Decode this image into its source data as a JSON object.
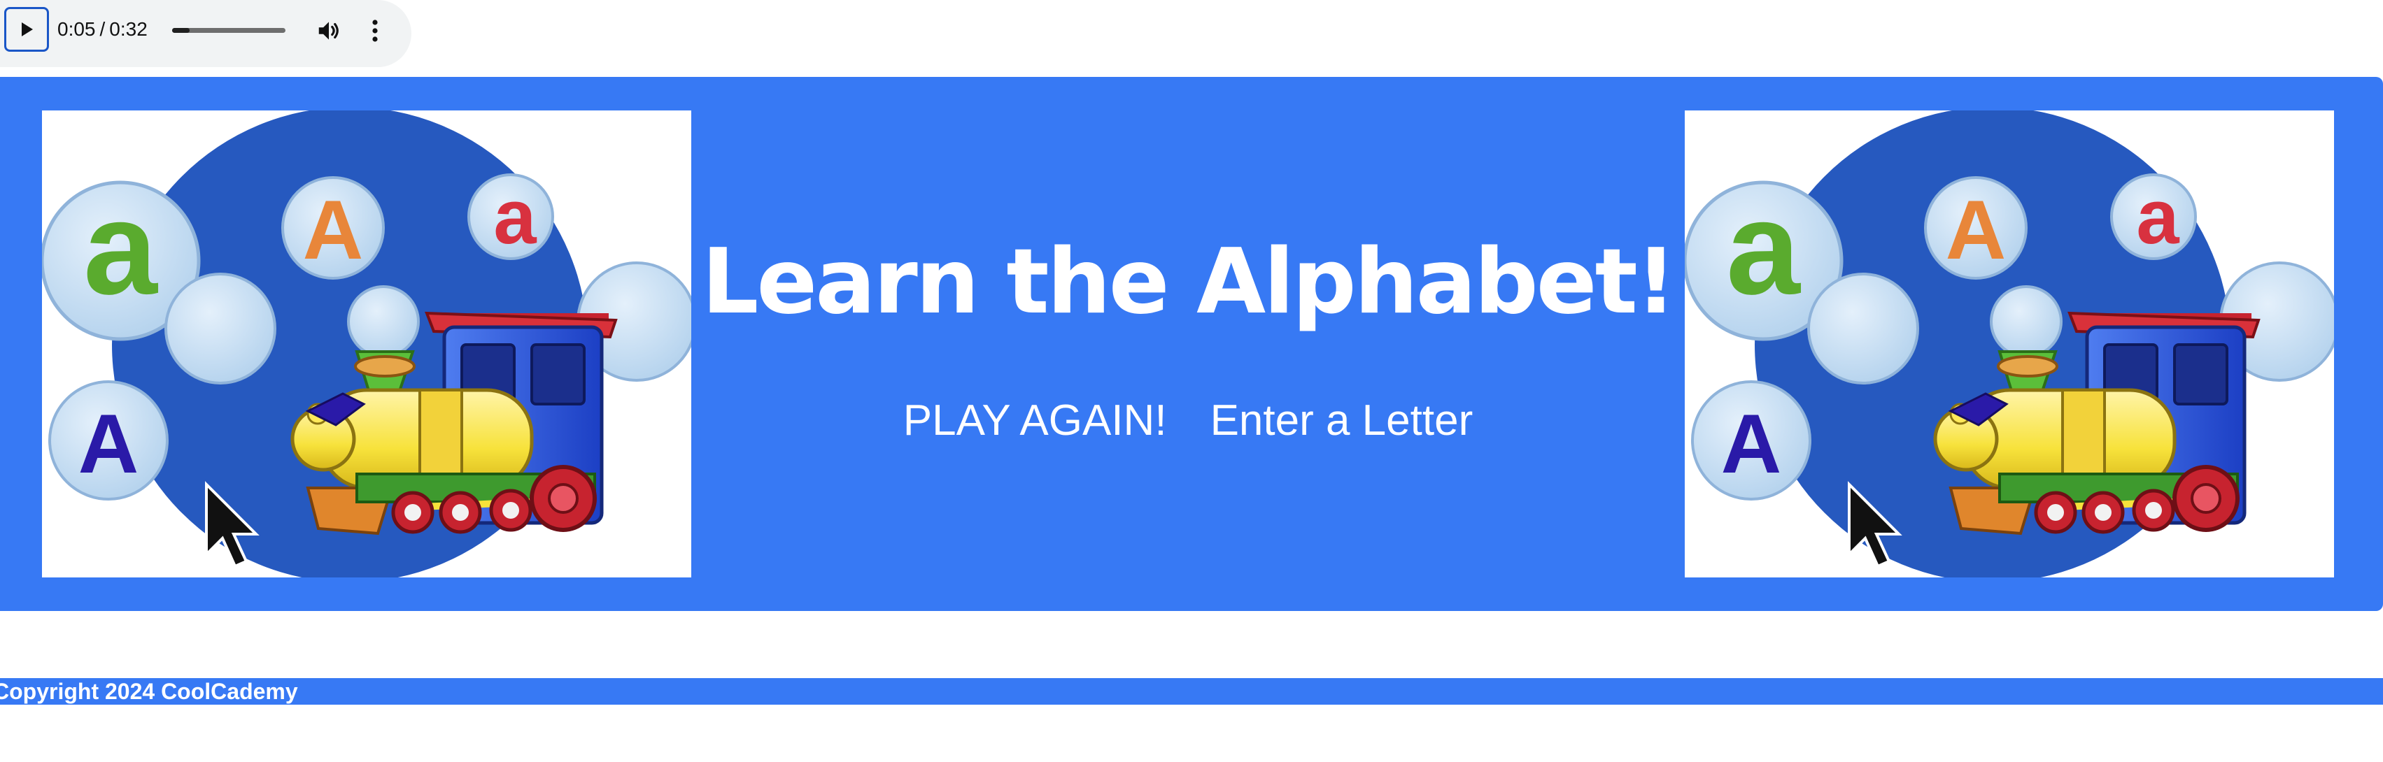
{
  "audio_player": {
    "current_time": "0:05",
    "separator": "/",
    "duration": "0:32",
    "progress_fraction": 0.156,
    "play_icon": "play-icon",
    "volume_icon": "volume-icon",
    "more_icon": "more-vertical-icon"
  },
  "banner": {
    "background_color": "#3779f4",
    "title": "Learn the Alphabet!",
    "links": [
      {
        "label": "PLAY AGAIN!"
      },
      {
        "label": "Enter a Letter"
      }
    ],
    "illustration": {
      "letters": [
        "a",
        "A",
        "a",
        "A"
      ],
      "letter_colors": [
        "#5aab2e",
        "#e8863a",
        "#d8313f",
        "#2a1aa8"
      ],
      "train_icon": "toy-train-icon",
      "cursor_icon": "mouse-cursor-icon"
    }
  },
  "footer": {
    "text": "Copyright 2024 CoolCademy",
    "background_color": "#3779f4"
  }
}
